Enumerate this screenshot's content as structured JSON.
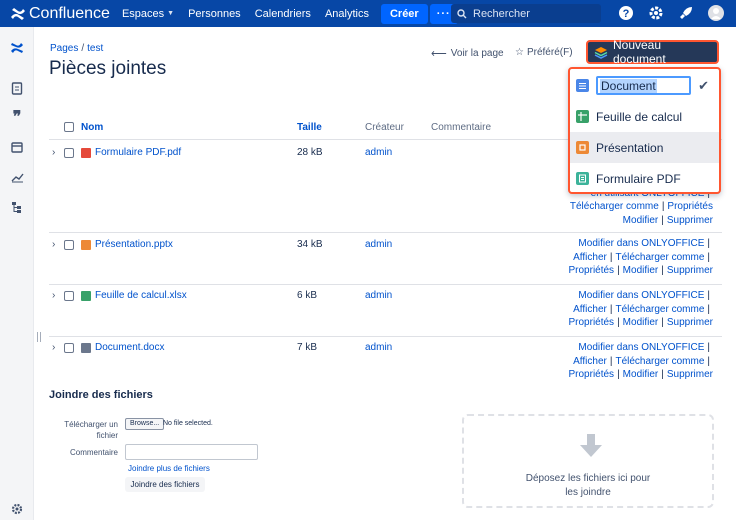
{
  "topbar": {
    "brand": "Confluence",
    "nav": [
      "Espaces",
      "Personnes",
      "Calendriers",
      "Analytics"
    ],
    "create_label": "Créer",
    "more_label": "···",
    "search_placeholder": "Rechercher"
  },
  "breadcrumb": {
    "root": "Pages",
    "sep": "/",
    "current": "test"
  },
  "page_title": "Pièces jointes",
  "actions": {
    "view_page": "Voir la page",
    "favorite": "Préféré(F)"
  },
  "new_document": {
    "label": "Nouveau document",
    "items": [
      {
        "label": "Document",
        "icon": "document-icon",
        "color": "#4a86e8"
      },
      {
        "label": "Feuille de calcul",
        "icon": "spreadsheet-icon",
        "color": "#38a169"
      },
      {
        "label": "Présentation",
        "icon": "presentation-icon",
        "color": "#ed8936"
      },
      {
        "label": "Formulaire PDF",
        "icon": "pdf-form-icon",
        "color": "#3cb39a"
      }
    ]
  },
  "table": {
    "headers": {
      "name": "Nom",
      "size": "Taille",
      "creator": "Créateur",
      "comment": "Commentaire"
    },
    "rows": [
      {
        "name": "Formulaire PDF.pdf",
        "size": "28 kB",
        "creator": "admin",
        "icon": "pdf-icon",
        "color": "#e5493a",
        "actions_partial": {
          "frag1": "O",
          "frag2": "en utilisant ONLYOFFICE",
          "a1": "Télécharger comme",
          "a2": "Propriétés",
          "a3": "Modifier",
          "a4": "Supprimer"
        }
      },
      {
        "name": "Présentation.pptx",
        "size": "34 kB",
        "creator": "admin",
        "icon": "presentation-file-icon",
        "color": "#ed8936",
        "actions": {
          "a1": "Modifier dans ONLYOFFICE",
          "a2": "Afficher",
          "a3": "Télécharger comme",
          "a4": "Propriétés",
          "a5": "Modifier",
          "a6": "Supprimer"
        }
      },
      {
        "name": "Feuille de calcul.xlsx",
        "size": "6 kB",
        "creator": "admin",
        "icon": "spreadsheet-file-icon",
        "color": "#38a169",
        "actions": {
          "a1": "Modifier dans ONLYOFFICE",
          "a2": "Afficher",
          "a3": "Télécharger comme",
          "a4": "Propriétés",
          "a5": "Modifier",
          "a6": "Supprimer"
        }
      },
      {
        "name": "Document.docx",
        "size": "7 kB",
        "creator": "admin",
        "icon": "document-file-icon",
        "color": "#6b778c",
        "actions": {
          "a1": "Modifier dans ONLYOFFICE",
          "a2": "Afficher",
          "a3": "Télécharger comme",
          "a4": "Propriétés",
          "a5": "Modifier",
          "a6": "Supprimer"
        }
      }
    ]
  },
  "attach": {
    "title": "Joindre des fichiers",
    "upload_label_1": "Télécharger un",
    "upload_label_2": "fichier",
    "browse": "Browse...",
    "no_file": "No file selected.",
    "comment_label": "Commentaire",
    "more_files": "Joindre plus de fichiers",
    "submit": "Joindre des fichiers",
    "drop_line1": "Déposez les fichiers ici pour",
    "drop_line2": "les joindre"
  }
}
